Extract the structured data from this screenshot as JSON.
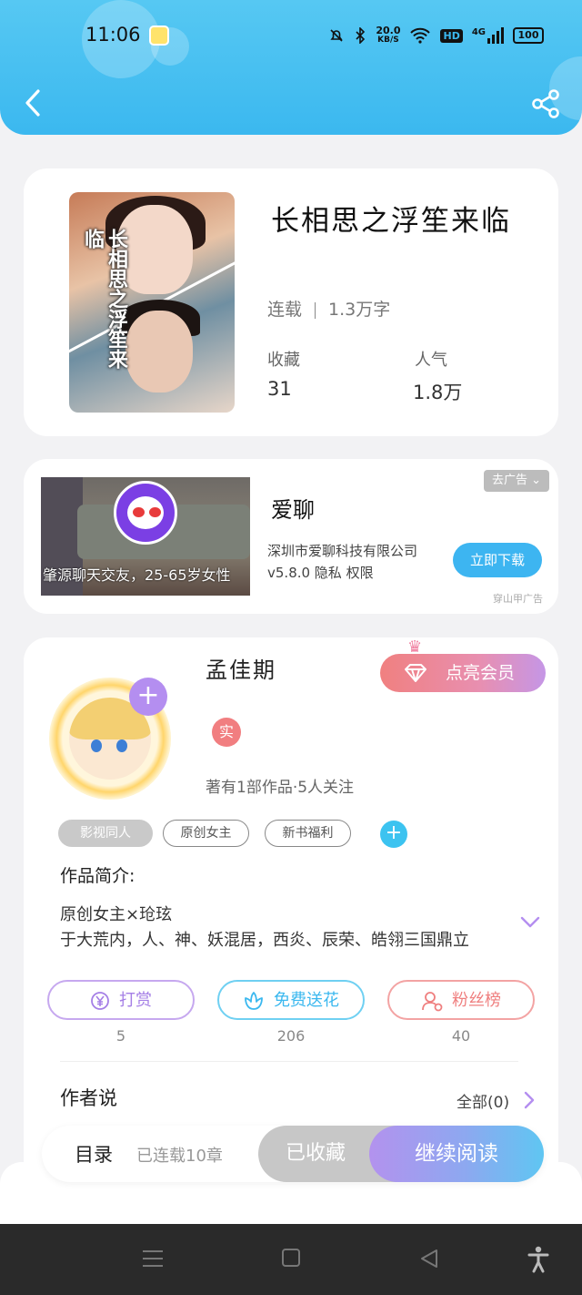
{
  "status_bar": {
    "time": "11:06",
    "net_speed_value": "20.0",
    "net_speed_unit": "KB/S",
    "hd_label": "HD",
    "signal_label": "4G",
    "battery": "100"
  },
  "colors": {
    "header_blue": "#3bb8ef",
    "accent_blue": "#3db5f1",
    "vip_pink": "#f08080",
    "purple": "#b48ef0"
  },
  "book": {
    "cover_text": "长相思之浮笙来临",
    "title": "长相思之浮笙来临",
    "status": "连载",
    "word_count": "1.3万字",
    "favorites_label": "收藏",
    "favorites_value": "31",
    "popularity_label": "人气",
    "popularity_value": "1.8万"
  },
  "ad": {
    "close_label": "去广告",
    "image_caption": "肇源聊天交友，25-65岁女性",
    "app_name": "爱聊",
    "company": "深圳市爱聊科技有限公司",
    "version_info": "v5.8.0 隐私 权限",
    "download_label": "立即下载",
    "source": "穿山甲广告"
  },
  "author": {
    "name": "孟佳期",
    "vip_label": "点亮会员",
    "verified_badge": "实",
    "stats": "著有1部作品·5人关注",
    "tags": [
      "影视同人",
      "原创女主",
      "新书福利"
    ],
    "tag_add": "+",
    "intro_label": "作品简介:",
    "intro_line1": "原创女主×玱玹",
    "intro_line2": "于大荒内，人、神、妖混居，西炎、辰荣、皓翎三国鼎立",
    "actions": [
      {
        "label": "打赏",
        "count": "5"
      },
      {
        "label": "免费送花",
        "count": "206"
      },
      {
        "label": "粉丝榜",
        "count": "40"
      }
    ],
    "section_title": "作者说",
    "section_more": "全部(0)"
  },
  "bottom_bar": {
    "toc_label": "目录",
    "toc_status": "已连载10章",
    "collected_label": "已收藏",
    "read_label": "继续阅读"
  },
  "icons": {
    "back": "back-arrow-icon",
    "share": "share-icon",
    "vip": "diamond-icon",
    "reward": "yen-coin-icon",
    "flower": "flower-icon",
    "fans": "fans-icon"
  }
}
